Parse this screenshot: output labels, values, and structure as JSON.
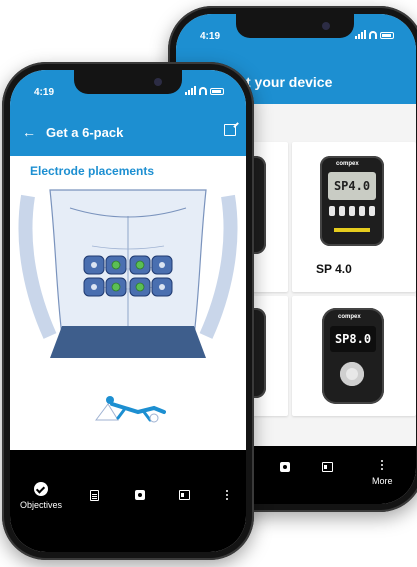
{
  "back_phone": {
    "status_time": "4:19",
    "header_title": "t your device",
    "devices": [
      {
        "name": "",
        "model_text": ""
      },
      {
        "name": "SP 4.0",
        "model_text": "SP4.0",
        "brand": "compex"
      },
      {
        "name": "",
        "model_text": ""
      },
      {
        "name": "",
        "model_text": "SP8.0",
        "brand": "compex"
      }
    ],
    "nav": {
      "more_label": "More"
    }
  },
  "front_phone": {
    "status_time": "4:19",
    "header_title": "Get a 6-pack",
    "section_title": "Electrode placements",
    "nav": {
      "objectives_label": "Objectives"
    }
  },
  "colors": {
    "accent": "#1d8fd1",
    "electrode_blue": "#4a6fb0",
    "electrode_green": "#5bbf55",
    "shorts": "#3e5e8c"
  },
  "icons": [
    "back-arrow-icon",
    "external-link-icon",
    "check-circle-icon",
    "clipboard-icon",
    "device-icon",
    "card-icon",
    "more-vertical-icon",
    "signal-icon",
    "wifi-icon",
    "battery-icon"
  ]
}
